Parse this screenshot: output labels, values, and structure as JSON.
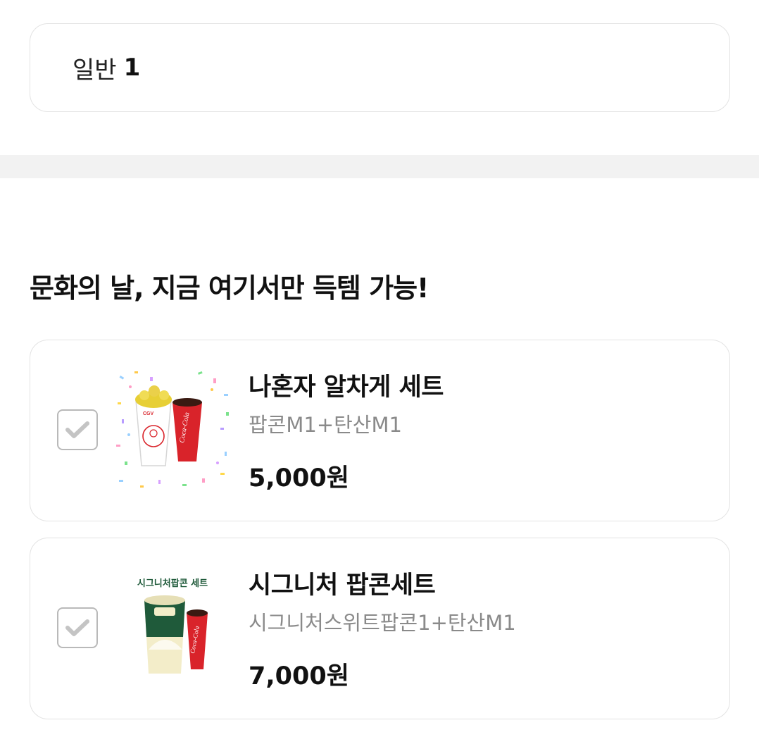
{
  "ticket": {
    "label": "일반",
    "count": "1"
  },
  "section": {
    "title": "문화의 날, 지금 여기서만 득템 가능!"
  },
  "products": [
    {
      "name": "나혼자 알차게 세트",
      "desc": "팝콘M1+탄산M1",
      "price": "5,000원",
      "checked": true,
      "image_icon": "popcorn-coke-confetti-image",
      "image_logo": "CGV",
      "image_cup_text": "Coca-Cola"
    },
    {
      "name": "시그니처 팝콘세트",
      "desc": "시그니처스위트팝콘1+탄산M1",
      "price": "7,000원",
      "checked": true,
      "image_icon": "signature-popcorn-set-image",
      "image_banner": "시그니처팝콘 세트",
      "image_cup_text": "Coca-Cola"
    }
  ],
  "colors": {
    "border": "#e3e3e3",
    "divider": "#f2f2f2",
    "check": "#c4c4c4",
    "coke_red": "#d9232a",
    "signature_green": "#1f5a3a"
  }
}
